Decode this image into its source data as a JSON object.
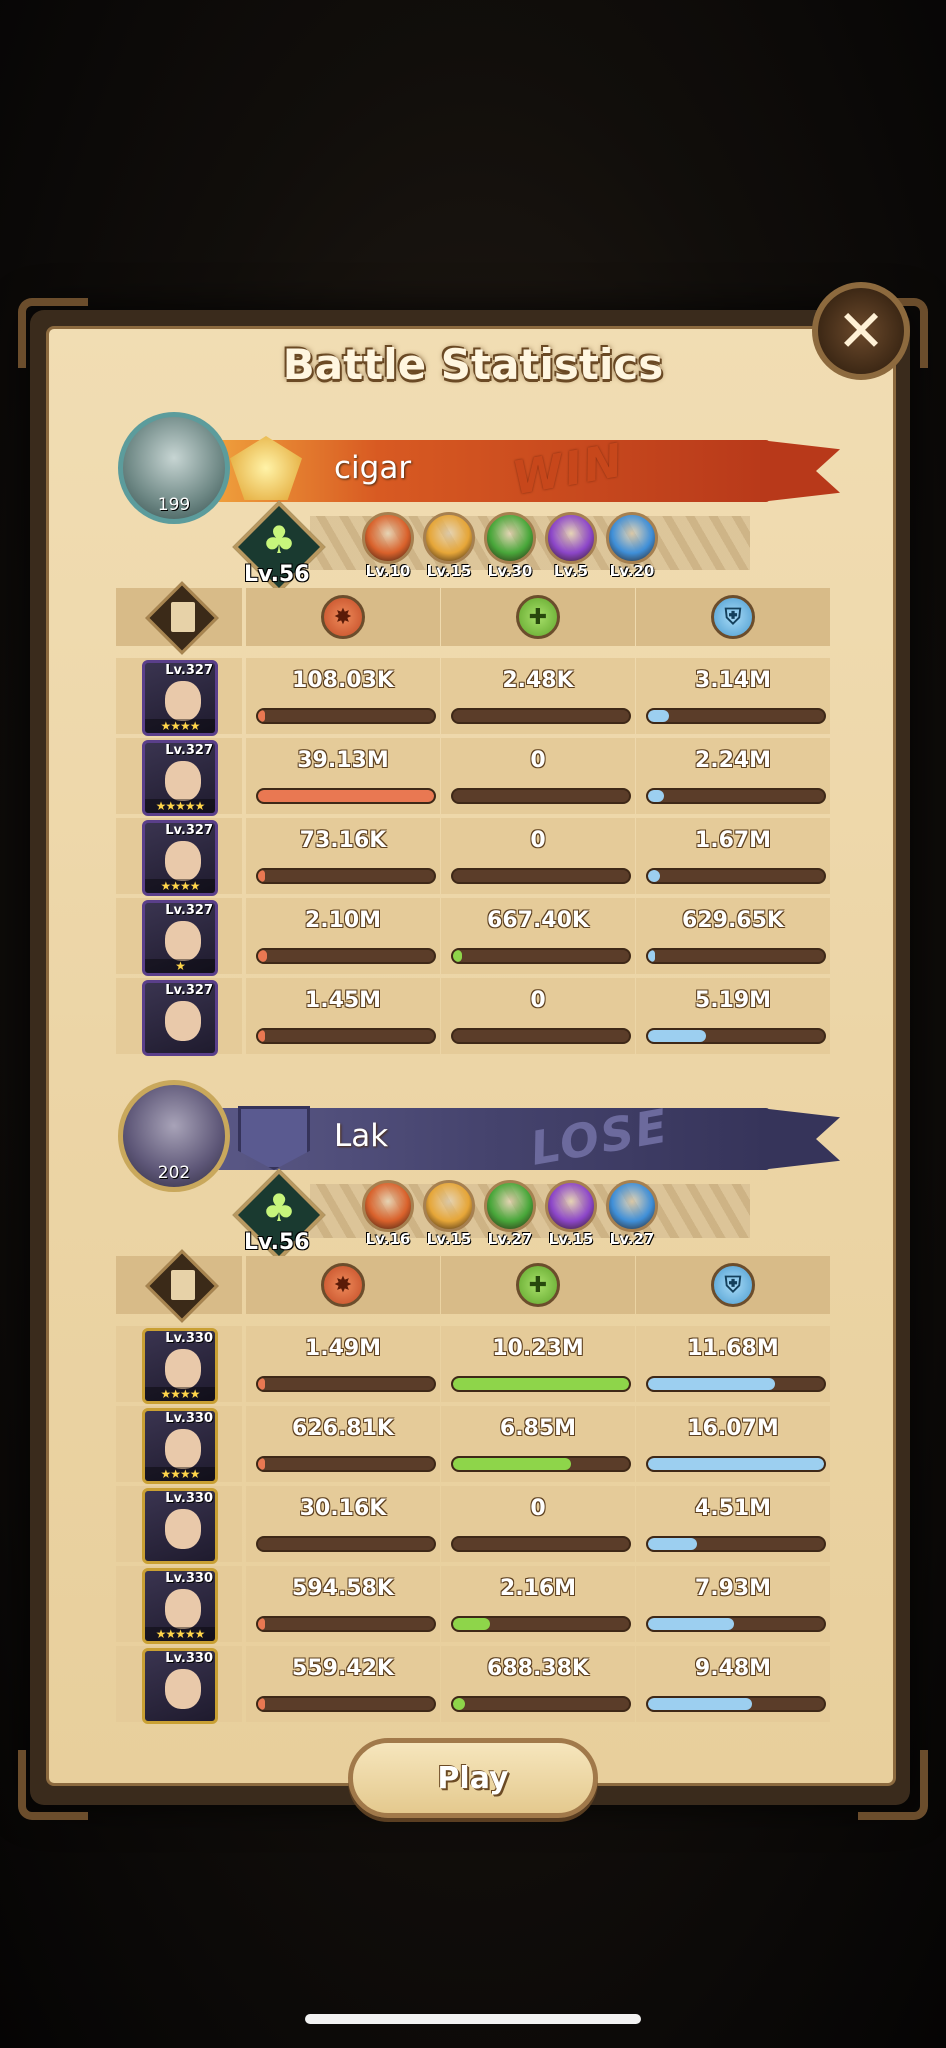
{
  "title": "Battle Statistics",
  "close_icon": "close-icon",
  "play_label": "Play",
  "stat_columns": [
    {
      "icon": "damage-icon",
      "color": "#e97852"
    },
    {
      "icon": "healing-icon",
      "color": "#8ed54a"
    },
    {
      "icon": "damage-taken-icon",
      "color": "#9ccff0"
    }
  ],
  "teams": [
    {
      "result": "WIN",
      "player_name": "cigar",
      "avatar_level": "199",
      "player_level": "Lv.56",
      "factions": [
        {
          "icon": "lightbearer-icon",
          "level": "Lv.10",
          "color": "#d9612b"
        },
        {
          "icon": "mauler-icon",
          "level": "Lv.15",
          "color": "#e6a638"
        },
        {
          "icon": "wilder-icon",
          "level": "Lv.30",
          "color": "#48a73a"
        },
        {
          "icon": "graveborn-icon",
          "level": "Lv.5",
          "color": "#8c46c9"
        },
        {
          "icon": "celestial-icon",
          "level": "Lv.20",
          "color": "#3f8fd8"
        }
      ],
      "heroes": [
        {
          "level": "Lv.327",
          "stars": "★★★★",
          "damage": "108.03K",
          "dmg_pct": 0.01,
          "healing": "2.48K",
          "heal_pct": 0.0,
          "taken": "3.14M",
          "taken_pct": 0.12
        },
        {
          "level": "Lv.327",
          "stars": "★★★★★",
          "damage": "39.13M",
          "dmg_pct": 1.0,
          "healing": "0",
          "heal_pct": 0.0,
          "taken": "2.24M",
          "taken_pct": 0.09
        },
        {
          "level": "Lv.327",
          "stars": "★★★★",
          "damage": "73.16K",
          "dmg_pct": 0.01,
          "healing": "0",
          "heal_pct": 0.0,
          "taken": "1.67M",
          "taken_pct": 0.07
        },
        {
          "level": "Lv.327",
          "stars": "★",
          "damage": "2.10M",
          "dmg_pct": 0.05,
          "healing": "667.40K",
          "heal_pct": 0.05,
          "taken": "629.65K",
          "taken_pct": 0.03
        },
        {
          "level": "Lv.327",
          "stars": "",
          "damage": "1.45M",
          "dmg_pct": 0.04,
          "healing": "0",
          "heal_pct": 0.0,
          "taken": "5.19M",
          "taken_pct": 0.33
        }
      ]
    },
    {
      "result": "LOSE",
      "player_name": "Lak",
      "avatar_level": "202",
      "player_level": "Lv.56",
      "factions": [
        {
          "icon": "lightbearer-icon",
          "level": "Lv.16",
          "color": "#d9612b"
        },
        {
          "icon": "mauler-icon",
          "level": "Lv.15",
          "color": "#e6a638"
        },
        {
          "icon": "wilder-icon",
          "level": "Lv.27",
          "color": "#48a73a"
        },
        {
          "icon": "graveborn-icon",
          "level": "Lv.15",
          "color": "#8c46c9"
        },
        {
          "icon": "celestial-icon",
          "level": "Lv.27",
          "color": "#3f8fd8"
        }
      ],
      "heroes": [
        {
          "level": "Lv.330",
          "stars": "★★★★",
          "damage": "1.49M",
          "dmg_pct": 0.04,
          "healing": "10.23M",
          "heal_pct": 1.0,
          "taken": "11.68M",
          "taken_pct": 0.72
        },
        {
          "level": "Lv.330",
          "stars": "★★★★",
          "damage": "626.81K",
          "dmg_pct": 0.02,
          "healing": "6.85M",
          "heal_pct": 0.67,
          "taken": "16.07M",
          "taken_pct": 1.0
        },
        {
          "level": "Lv.330",
          "stars": "",
          "damage": "30.16K",
          "dmg_pct": 0.0,
          "healing": "0",
          "heal_pct": 0.0,
          "taken": "4.51M",
          "taken_pct": 0.28
        },
        {
          "level": "Lv.330",
          "stars": "★★★★★",
          "damage": "594.58K",
          "dmg_pct": 0.02,
          "healing": "2.16M",
          "heal_pct": 0.21,
          "taken": "7.93M",
          "taken_pct": 0.49
        },
        {
          "level": "Lv.330",
          "stars": "",
          "damage": "559.42K",
          "dmg_pct": 0.01,
          "healing": "688.38K",
          "heal_pct": 0.07,
          "taken": "9.48M",
          "taken_pct": 0.59
        }
      ]
    }
  ]
}
